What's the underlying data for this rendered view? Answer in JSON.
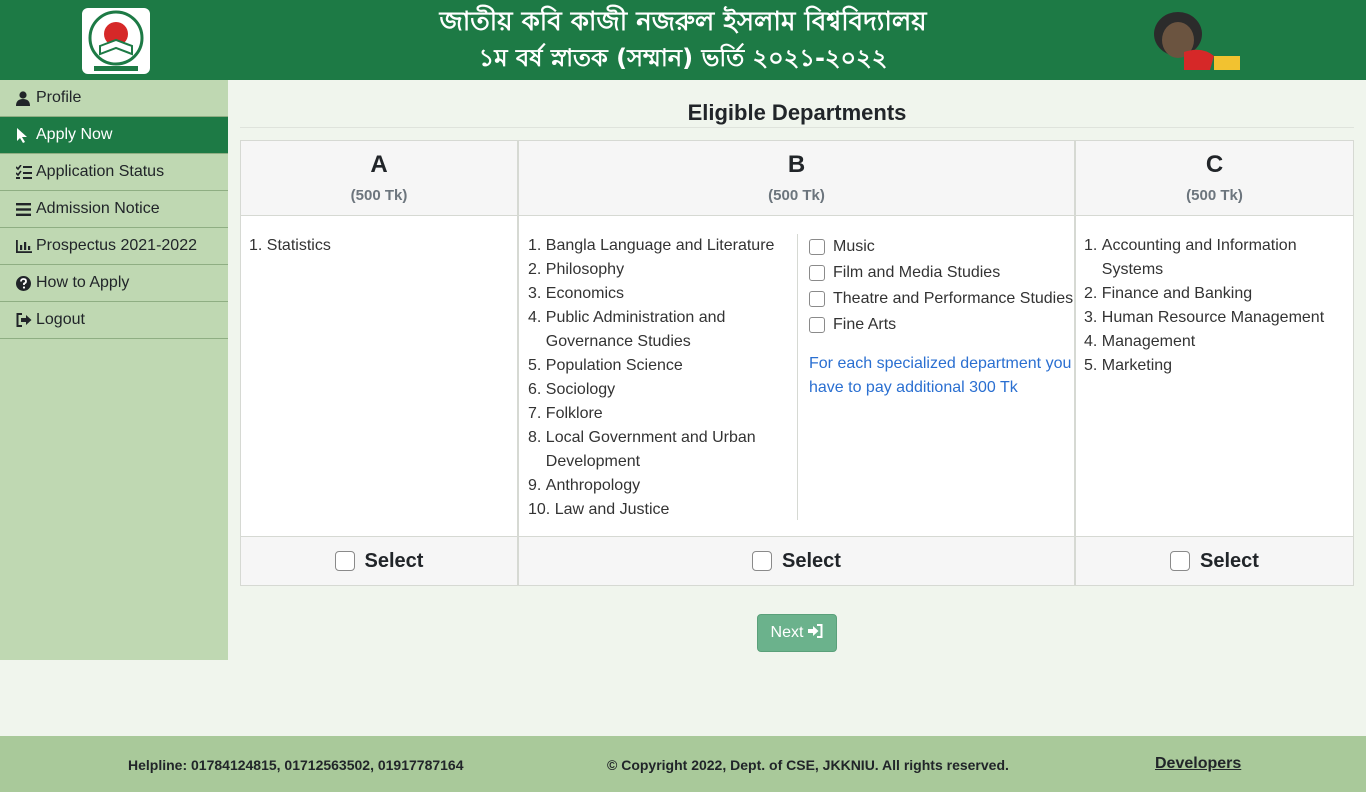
{
  "header": {
    "title_line1": "জাতীয় কবি কাজী নজরুল ইসলাম বিশ্ববিদ্যালয়",
    "title_line2": "১ম বর্ষ স্নাতক (সম্মান) ভর্তি ২০২১-২০২২",
    "logo_left_icon": "university-seal-logo",
    "logo_right_icon": "mujib-100-logo",
    "brand_color": "#1d7a45"
  },
  "sidebar": {
    "items": [
      {
        "label": "Profile",
        "icon": "user-icon",
        "active": false
      },
      {
        "label": "Apply Now",
        "icon": "pointer-icon",
        "active": true
      },
      {
        "label": "Application Status",
        "icon": "list-check-icon",
        "active": false
      },
      {
        "label": "Admission Notice",
        "icon": "menu-icon",
        "active": false
      },
      {
        "label": "Prospectus 2021-2022",
        "icon": "bar-chart-icon",
        "active": false
      },
      {
        "label": "How to Apply",
        "icon": "question-circle-icon",
        "active": false
      },
      {
        "label": "Logout",
        "icon": "sign-out-icon",
        "active": false
      }
    ]
  },
  "main": {
    "title": "Eligible Departments",
    "units": [
      {
        "letter": "A",
        "fee": "(500 Tk)",
        "departments": [
          {
            "num": "1. ",
            "name": "Statistics"
          }
        ],
        "select_label": "Select"
      },
      {
        "letter": "B",
        "fee": "(500 Tk)",
        "departments": [
          {
            "num": "1. ",
            "name": "Bangla Language and Literature"
          },
          {
            "num": "2. ",
            "name": "Philosophy"
          },
          {
            "num": "3. ",
            "name": "Economics"
          },
          {
            "num": "4. ",
            "name": "Public Administration and Governance Studies"
          },
          {
            "num": "5. ",
            "name": "Population Science"
          },
          {
            "num": "6. ",
            "name": "Sociology"
          },
          {
            "num": "7. ",
            "name": "Folklore"
          },
          {
            "num": "8. ",
            "name": "Local Government and Urban Development"
          },
          {
            "num": "9. ",
            "name": "Anthropology"
          },
          {
            "num": "10. ",
            "name": "Law and Justice"
          }
        ],
        "specialized": [
          "Music",
          "Film and Media Studies",
          "Theatre and Performance Studies",
          "Fine Arts"
        ],
        "specialized_note": "For each specialized department you have to pay additional 300 Tk",
        "select_label": "Select"
      },
      {
        "letter": "C",
        "fee": "(500 Tk)",
        "departments": [
          {
            "num": "1. ",
            "name": "Accounting and Information Systems"
          },
          {
            "num": "2. ",
            "name": "Finance and Banking"
          },
          {
            "num": "3. ",
            "name": "Human Resource Management"
          },
          {
            "num": "4. ",
            "name": "Management"
          },
          {
            "num": "5. ",
            "name": "Marketing"
          }
        ],
        "select_label": "Select"
      }
    ],
    "next_label": "Next"
  },
  "footer": {
    "helpline": "Helpline: 01784124815, 01712563502, 01917787164",
    "copyright": "© Copyright 2022, Dept. of CSE, JKKNIU. All rights reserved.",
    "developers": "Developers"
  }
}
